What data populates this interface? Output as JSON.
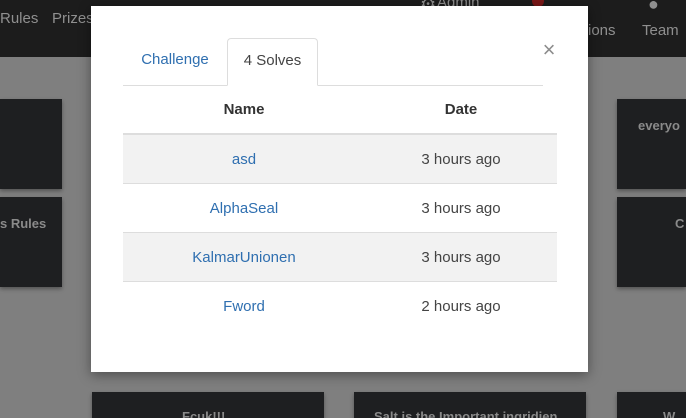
{
  "background": {
    "nav": {
      "rules": "Rules",
      "prizes": "Prizes",
      "admin": "Admin",
      "notifications": "ions",
      "team": "Team"
    },
    "cards": {
      "left_mid": "s Rules",
      "right_top": "everyo",
      "right_mid": "C",
      "bottom_left": "Fcuk!!!",
      "bottom_mid": "Salt is the Important ingridien",
      "bottom_right": "W"
    }
  },
  "modal": {
    "close_label": "×",
    "tabs": [
      {
        "label": "Challenge",
        "active": false
      },
      {
        "label": "4 Solves",
        "active": true
      }
    ],
    "table": {
      "headers": {
        "name": "Name",
        "date": "Date"
      },
      "rows": [
        {
          "name": "asd",
          "date": "3 hours ago"
        },
        {
          "name": "AlphaSeal",
          "date": "3 hours ago"
        },
        {
          "name": "KalmarUnionen",
          "date": "3 hours ago"
        },
        {
          "name": "Fword",
          "date": "2 hours ago"
        }
      ]
    }
  },
  "colors": {
    "link": "#2f6fb0",
    "backdrop": "#7f7f7f",
    "navbar": "#1c1c1c",
    "card": "#1e1f21",
    "stripe": "#f2f2f2"
  }
}
